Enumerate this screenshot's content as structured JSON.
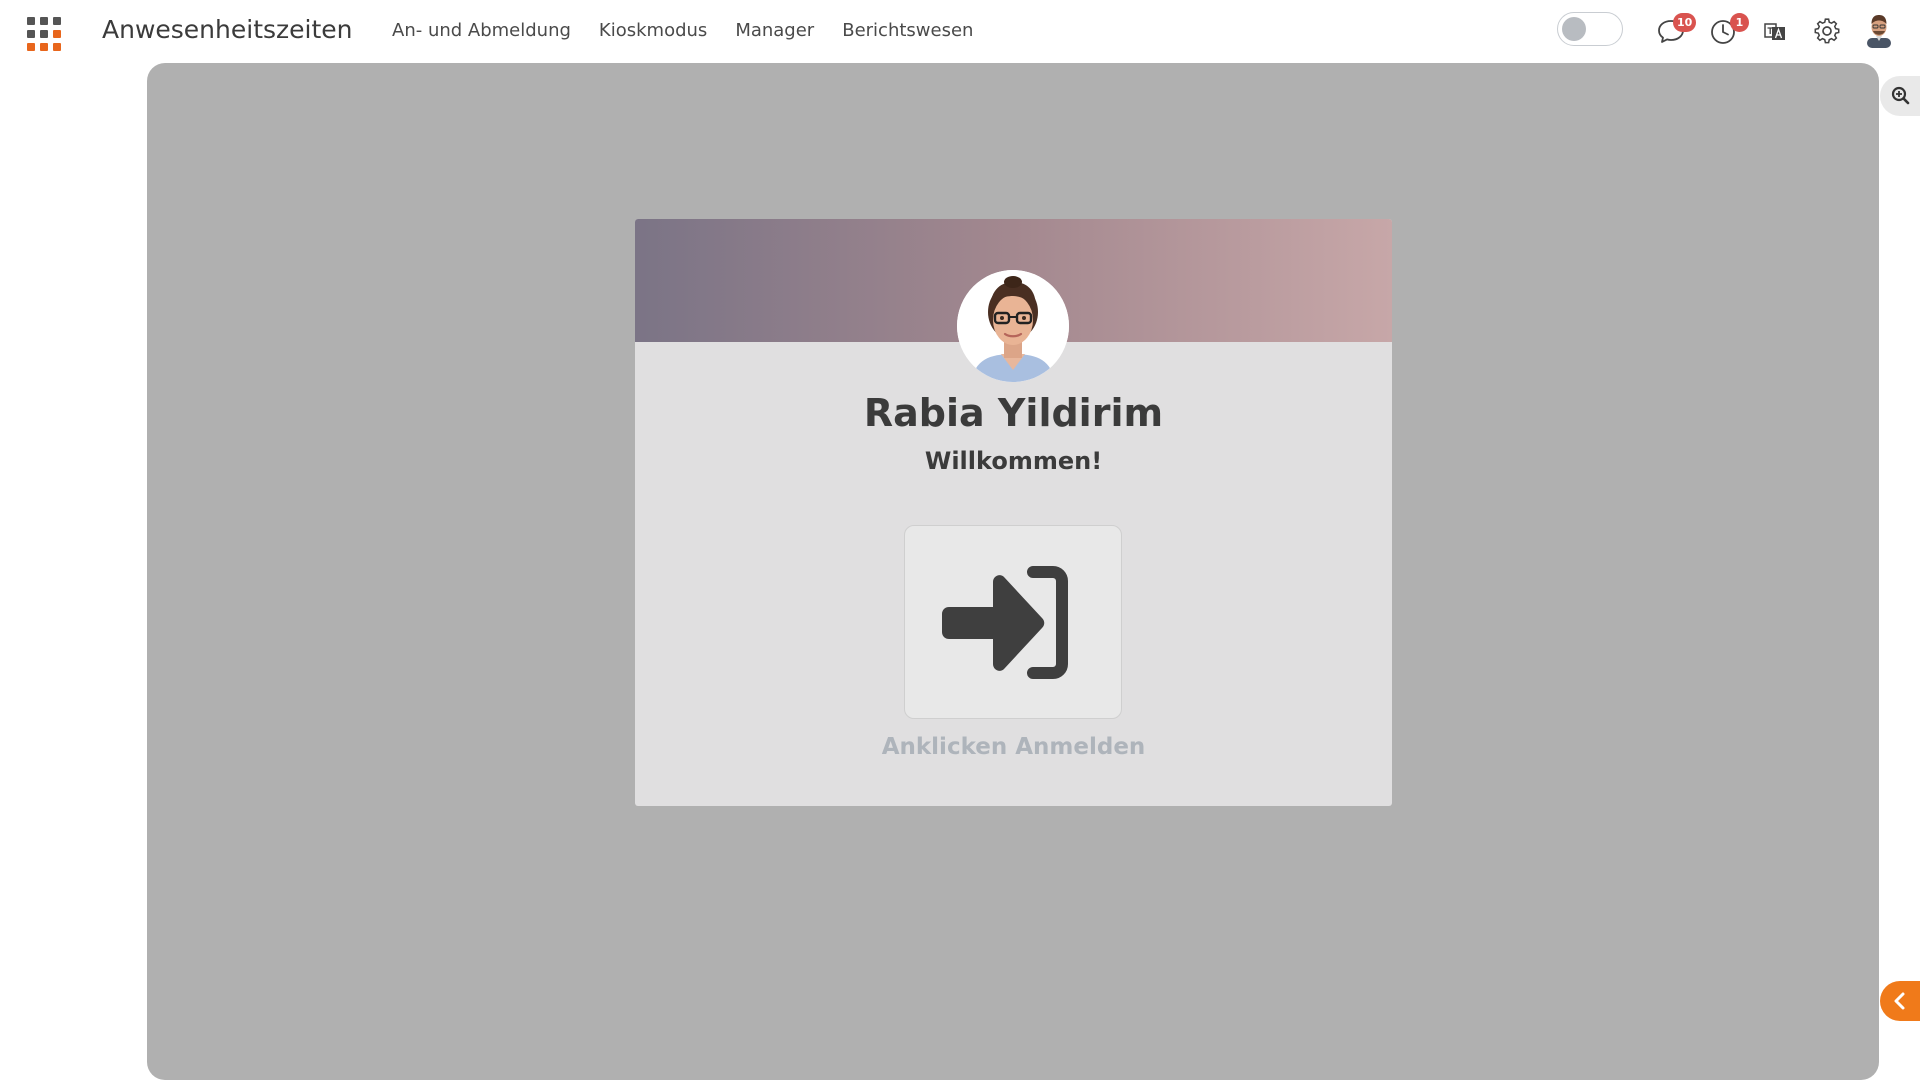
{
  "header": {
    "app_title": "Anwesenheitszeiten",
    "nav": [
      {
        "label": "An- und Abmeldung"
      },
      {
        "label": "Kioskmodus"
      },
      {
        "label": "Manager"
      },
      {
        "label": "Berichtswesen"
      }
    ],
    "toggle_on": false,
    "chat_badge": "10",
    "clock_badge": "1",
    "icons": [
      "apps-grid-icon",
      "chat-icon",
      "clock-icon",
      "translate-icon",
      "gear-icon"
    ]
  },
  "card": {
    "user_name": "Rabia Yildirim",
    "greeting": "Willkommen!",
    "action_label": "Anklicken Anmelden",
    "action_icon": "sign-in-icon"
  },
  "colors": {
    "accent": "#f07a1a",
    "apps_grid_dark": "#555555",
    "apps_grid_accent": "#e8661c",
    "badge": "#d9534f",
    "panel_bg": "#b0b0b0",
    "card_bg": "#e0dfe0",
    "header_gradient_start": "#7b7486",
    "header_gradient_end": "#c7a7a8"
  }
}
